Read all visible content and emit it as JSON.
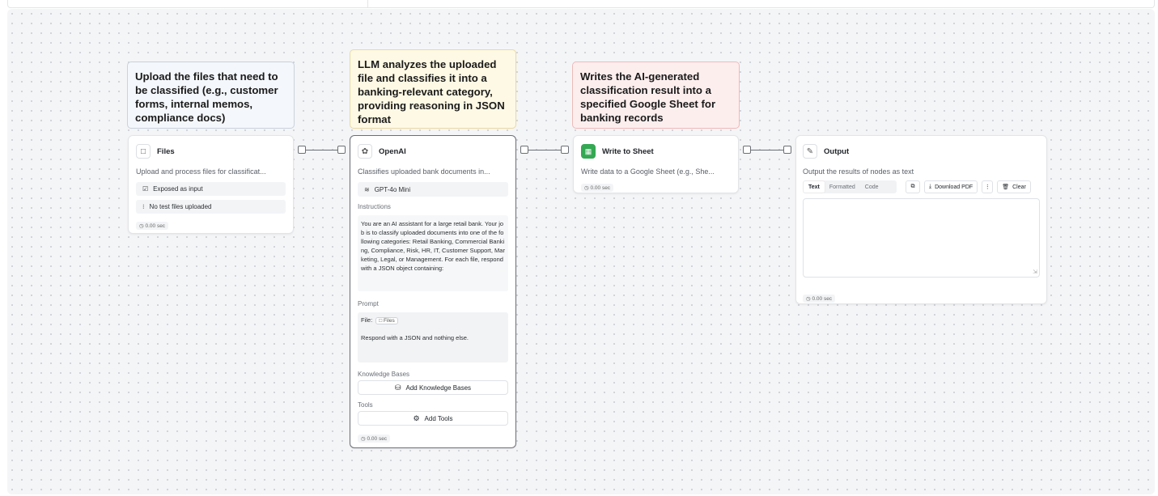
{
  "notes": {
    "files_note": "Upload the files that need to be classified (e.g., customer forms, internal memos, compliance docs)",
    "llm_note": "LLM analyzes the uploaded file and classifies it into a banking-relevant category, providing reasoning in JSON format",
    "sheet_note": "Writes the AI-generated classification result into a specified Google Sheet for banking records"
  },
  "files_node": {
    "title": "Files",
    "description": "Upload and process files for classificat...",
    "exposed_label": "Exposed as input",
    "no_files_label": "No test files uploaded",
    "timer": "0.00 sec"
  },
  "openai_node": {
    "title": "OpenAI",
    "description": "Classifies uploaded bank documents in...",
    "model": "GPT-4o Mini",
    "instructions_label": "Instructions",
    "instructions_text": "You are an AI assistant for a large retail bank. Your job is to classify uploaded documents into one of the following categories: Retail Banking, Commercial Banking, Compliance, Risk, HR, IT, Customer Support, Marketing, Legal, or Management. For each file, respond with a JSON object containing:",
    "prompt_label": "Prompt",
    "prompt_file_prefix": "File:",
    "prompt_file_tag": "Files",
    "prompt_text": "Respond with a JSON and nothing else.",
    "kb_label": "Knowledge Bases",
    "kb_button": "Add Knowledge Bases",
    "tools_label": "Tools",
    "tools_button": "Add Tools",
    "timer": "0.00 sec"
  },
  "sheet_node": {
    "title": "Write to Sheet",
    "description": "Write data to a Google Sheet (e.g., She...",
    "timer": "0.00 sec",
    "icon_color": "#34a853"
  },
  "output_node": {
    "title": "Output",
    "description": "Output the results of nodes as text",
    "tabs": [
      "Text",
      "Formatted",
      "Code"
    ],
    "download_label": "Download PDF",
    "more_label": "⋮",
    "clear_label": "Clear",
    "timer": "0.00 sec"
  }
}
